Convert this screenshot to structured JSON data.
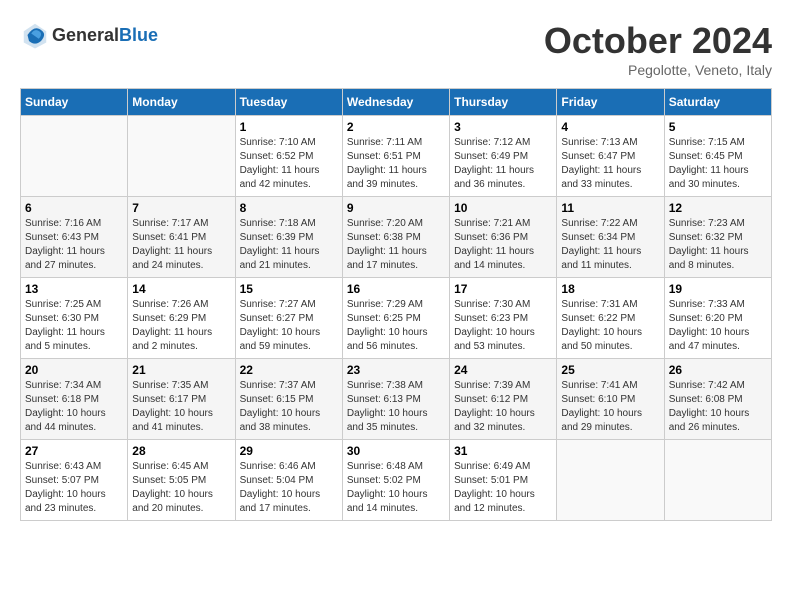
{
  "header": {
    "logo_general": "General",
    "logo_blue": "Blue",
    "title": "October 2024",
    "location": "Pegolotte, Veneto, Italy"
  },
  "calendar": {
    "days_of_week": [
      "Sunday",
      "Monday",
      "Tuesday",
      "Wednesday",
      "Thursday",
      "Friday",
      "Saturday"
    ],
    "weeks": [
      [
        {
          "day": "",
          "sunrise": "",
          "sunset": "",
          "daylight": ""
        },
        {
          "day": "",
          "sunrise": "",
          "sunset": "",
          "daylight": ""
        },
        {
          "day": "1",
          "sunrise": "Sunrise: 7:10 AM",
          "sunset": "Sunset: 6:52 PM",
          "daylight": "Daylight: 11 hours and 42 minutes."
        },
        {
          "day": "2",
          "sunrise": "Sunrise: 7:11 AM",
          "sunset": "Sunset: 6:51 PM",
          "daylight": "Daylight: 11 hours and 39 minutes."
        },
        {
          "day": "3",
          "sunrise": "Sunrise: 7:12 AM",
          "sunset": "Sunset: 6:49 PM",
          "daylight": "Daylight: 11 hours and 36 minutes."
        },
        {
          "day": "4",
          "sunrise": "Sunrise: 7:13 AM",
          "sunset": "Sunset: 6:47 PM",
          "daylight": "Daylight: 11 hours and 33 minutes."
        },
        {
          "day": "5",
          "sunrise": "Sunrise: 7:15 AM",
          "sunset": "Sunset: 6:45 PM",
          "daylight": "Daylight: 11 hours and 30 minutes."
        }
      ],
      [
        {
          "day": "6",
          "sunrise": "Sunrise: 7:16 AM",
          "sunset": "Sunset: 6:43 PM",
          "daylight": "Daylight: 11 hours and 27 minutes."
        },
        {
          "day": "7",
          "sunrise": "Sunrise: 7:17 AM",
          "sunset": "Sunset: 6:41 PM",
          "daylight": "Daylight: 11 hours and 24 minutes."
        },
        {
          "day": "8",
          "sunrise": "Sunrise: 7:18 AM",
          "sunset": "Sunset: 6:39 PM",
          "daylight": "Daylight: 11 hours and 21 minutes."
        },
        {
          "day": "9",
          "sunrise": "Sunrise: 7:20 AM",
          "sunset": "Sunset: 6:38 PM",
          "daylight": "Daylight: 11 hours and 17 minutes."
        },
        {
          "day": "10",
          "sunrise": "Sunrise: 7:21 AM",
          "sunset": "Sunset: 6:36 PM",
          "daylight": "Daylight: 11 hours and 14 minutes."
        },
        {
          "day": "11",
          "sunrise": "Sunrise: 7:22 AM",
          "sunset": "Sunset: 6:34 PM",
          "daylight": "Daylight: 11 hours and 11 minutes."
        },
        {
          "day": "12",
          "sunrise": "Sunrise: 7:23 AM",
          "sunset": "Sunset: 6:32 PM",
          "daylight": "Daylight: 11 hours and 8 minutes."
        }
      ],
      [
        {
          "day": "13",
          "sunrise": "Sunrise: 7:25 AM",
          "sunset": "Sunset: 6:30 PM",
          "daylight": "Daylight: 11 hours and 5 minutes."
        },
        {
          "day": "14",
          "sunrise": "Sunrise: 7:26 AM",
          "sunset": "Sunset: 6:29 PM",
          "daylight": "Daylight: 11 hours and 2 minutes."
        },
        {
          "day": "15",
          "sunrise": "Sunrise: 7:27 AM",
          "sunset": "Sunset: 6:27 PM",
          "daylight": "Daylight: 10 hours and 59 minutes."
        },
        {
          "day": "16",
          "sunrise": "Sunrise: 7:29 AM",
          "sunset": "Sunset: 6:25 PM",
          "daylight": "Daylight: 10 hours and 56 minutes."
        },
        {
          "day": "17",
          "sunrise": "Sunrise: 7:30 AM",
          "sunset": "Sunset: 6:23 PM",
          "daylight": "Daylight: 10 hours and 53 minutes."
        },
        {
          "day": "18",
          "sunrise": "Sunrise: 7:31 AM",
          "sunset": "Sunset: 6:22 PM",
          "daylight": "Daylight: 10 hours and 50 minutes."
        },
        {
          "day": "19",
          "sunrise": "Sunrise: 7:33 AM",
          "sunset": "Sunset: 6:20 PM",
          "daylight": "Daylight: 10 hours and 47 minutes."
        }
      ],
      [
        {
          "day": "20",
          "sunrise": "Sunrise: 7:34 AM",
          "sunset": "Sunset: 6:18 PM",
          "daylight": "Daylight: 10 hours and 44 minutes."
        },
        {
          "day": "21",
          "sunrise": "Sunrise: 7:35 AM",
          "sunset": "Sunset: 6:17 PM",
          "daylight": "Daylight: 10 hours and 41 minutes."
        },
        {
          "day": "22",
          "sunrise": "Sunrise: 7:37 AM",
          "sunset": "Sunset: 6:15 PM",
          "daylight": "Daylight: 10 hours and 38 minutes."
        },
        {
          "day": "23",
          "sunrise": "Sunrise: 7:38 AM",
          "sunset": "Sunset: 6:13 PM",
          "daylight": "Daylight: 10 hours and 35 minutes."
        },
        {
          "day": "24",
          "sunrise": "Sunrise: 7:39 AM",
          "sunset": "Sunset: 6:12 PM",
          "daylight": "Daylight: 10 hours and 32 minutes."
        },
        {
          "day": "25",
          "sunrise": "Sunrise: 7:41 AM",
          "sunset": "Sunset: 6:10 PM",
          "daylight": "Daylight: 10 hours and 29 minutes."
        },
        {
          "day": "26",
          "sunrise": "Sunrise: 7:42 AM",
          "sunset": "Sunset: 6:08 PM",
          "daylight": "Daylight: 10 hours and 26 minutes."
        }
      ],
      [
        {
          "day": "27",
          "sunrise": "Sunrise: 6:43 AM",
          "sunset": "Sunset: 5:07 PM",
          "daylight": "Daylight: 10 hours and 23 minutes."
        },
        {
          "day": "28",
          "sunrise": "Sunrise: 6:45 AM",
          "sunset": "Sunset: 5:05 PM",
          "daylight": "Daylight: 10 hours and 20 minutes."
        },
        {
          "day": "29",
          "sunrise": "Sunrise: 6:46 AM",
          "sunset": "Sunset: 5:04 PM",
          "daylight": "Daylight: 10 hours and 17 minutes."
        },
        {
          "day": "30",
          "sunrise": "Sunrise: 6:48 AM",
          "sunset": "Sunset: 5:02 PM",
          "daylight": "Daylight: 10 hours and 14 minutes."
        },
        {
          "day": "31",
          "sunrise": "Sunrise: 6:49 AM",
          "sunset": "Sunset: 5:01 PM",
          "daylight": "Daylight: 10 hours and 12 minutes."
        },
        {
          "day": "",
          "sunrise": "",
          "sunset": "",
          "daylight": ""
        },
        {
          "day": "",
          "sunrise": "",
          "sunset": "",
          "daylight": ""
        }
      ]
    ]
  }
}
